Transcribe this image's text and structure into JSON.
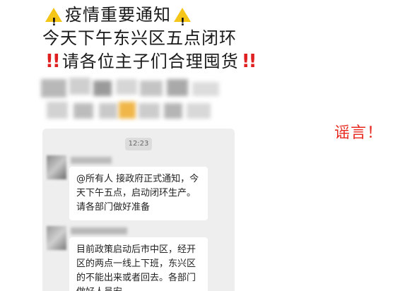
{
  "headline": {
    "line1": "疫情重要通知",
    "line2": "今天下午东兴区五点闭环",
    "line3": "请各位主子们合理囤货"
  },
  "chat": {
    "time": "12:23",
    "messages": [
      {
        "text": "@所有人 接政府正式通知，今天下午五点，启动闭环生产。请各部门做好准备"
      },
      {
        "text": "目前政策启动后市中区，经开区的两点一线上下班，东兴区的不能出来或者回去。各部门做好人员安"
      }
    ]
  },
  "annotation": {
    "label": "谣言！"
  },
  "colors": {
    "warning_yellow": "#f5c518",
    "alert_red": "#e02020",
    "rumor_red": "#e8281e",
    "chat_bg": "#eeeeee"
  },
  "icons": [
    "warning-icon",
    "double-exclamation-icon"
  ]
}
